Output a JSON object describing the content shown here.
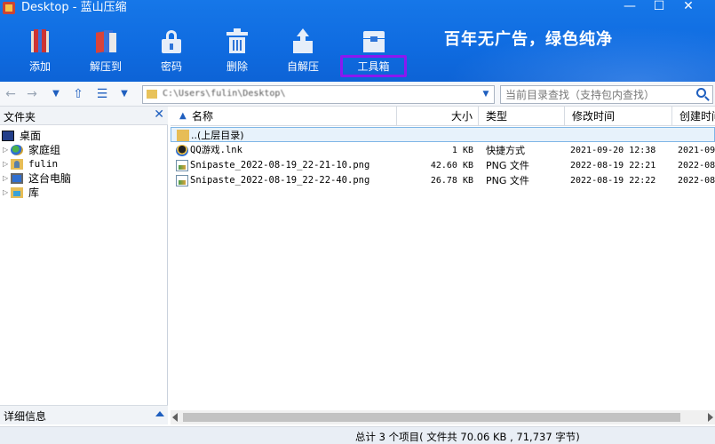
{
  "window": {
    "title": "Desktop - 蓝山压缩",
    "minimize": "—",
    "maximize": "☐",
    "close": "✕"
  },
  "toolbar": {
    "add": "添加",
    "extract": "解压到",
    "password": "密码",
    "delete": "删除",
    "sfx": "自解压",
    "toolbox": "工具箱",
    "highlight_color": "#8a18f0",
    "slogan": "百年无广告，绿色纯净"
  },
  "navigation": {
    "back": "←",
    "forward": "→",
    "history": "▼",
    "up": "⇧",
    "view": "☰",
    "view_dropdown": "▼",
    "address": "C:\\Users\\fulin\\Desktop\\",
    "address_dropdown": "▼"
  },
  "search": {
    "placeholder": "当前目录查找（支持包内查找）"
  },
  "left_pane": {
    "header": "文件夹",
    "close": "✕",
    "tree": [
      {
        "label": "桌面",
        "icon": "desktop-icon"
      },
      {
        "label": "家庭组",
        "icon": "homegroup-icon",
        "expander": "▷"
      },
      {
        "label": "fulin",
        "icon": "user-folder-icon",
        "expander": "▷"
      },
      {
        "label": "这台电脑",
        "icon": "computer-icon",
        "expander": "▷"
      },
      {
        "label": "库",
        "icon": "library-icon",
        "expander": "▷"
      }
    ],
    "detail_label": "详细信息"
  },
  "file_list": {
    "columns": {
      "name": "名称",
      "size": "大小",
      "type": "类型",
      "modified": "修改时间",
      "created": "创建时间"
    },
    "sort_indicator": "▲",
    "parent_row": "..(上层目录)",
    "rows": [
      {
        "name": "QQ游戏.lnk",
        "size": "1 KB",
        "type": "快捷方式",
        "modified": "2021-09-20 12:38",
        "created": "2021-09"
      },
      {
        "name": "Snipaste_2022-08-19_22-21-10.png",
        "size": "42.60 KB",
        "type": "PNG 文件",
        "modified": "2022-08-19 22:21",
        "created": "2022-08"
      },
      {
        "name": "Snipaste_2022-08-19_22-22-40.png",
        "size": "26.78 KB",
        "type": "PNG 文件",
        "modified": "2022-08-19 22:22",
        "created": "2022-08"
      }
    ]
  },
  "status": {
    "text": "总计 3 个项目( 文件共 70.06 KB , 71,737 字节)"
  }
}
